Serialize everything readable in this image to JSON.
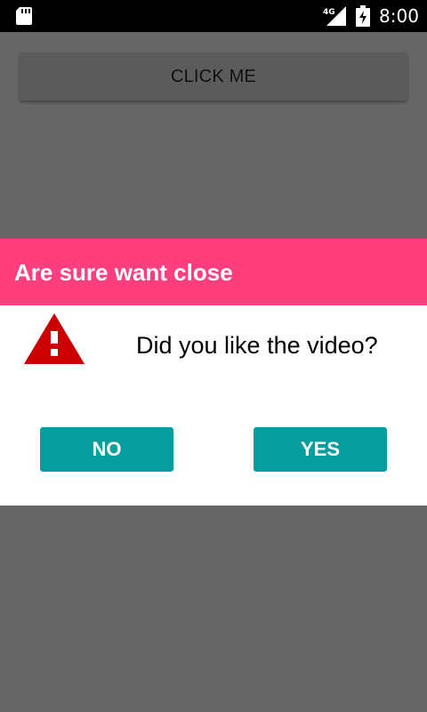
{
  "status_bar": {
    "time": "8:00",
    "network": "4G",
    "icons": [
      "sd-card-icon",
      "signal-icon",
      "battery-charging-icon"
    ]
  },
  "main": {
    "button_label": "CLICK ME"
  },
  "dialog": {
    "title": "Are sure want close",
    "message": "Did you like the video?",
    "icon": "warning-icon",
    "no_label": "NO",
    "yes_label": "YES"
  },
  "colors": {
    "dialog_header": "#ff3f7d",
    "button": "#089e9d",
    "overlay": "#666666",
    "warning": "#cc0000"
  }
}
